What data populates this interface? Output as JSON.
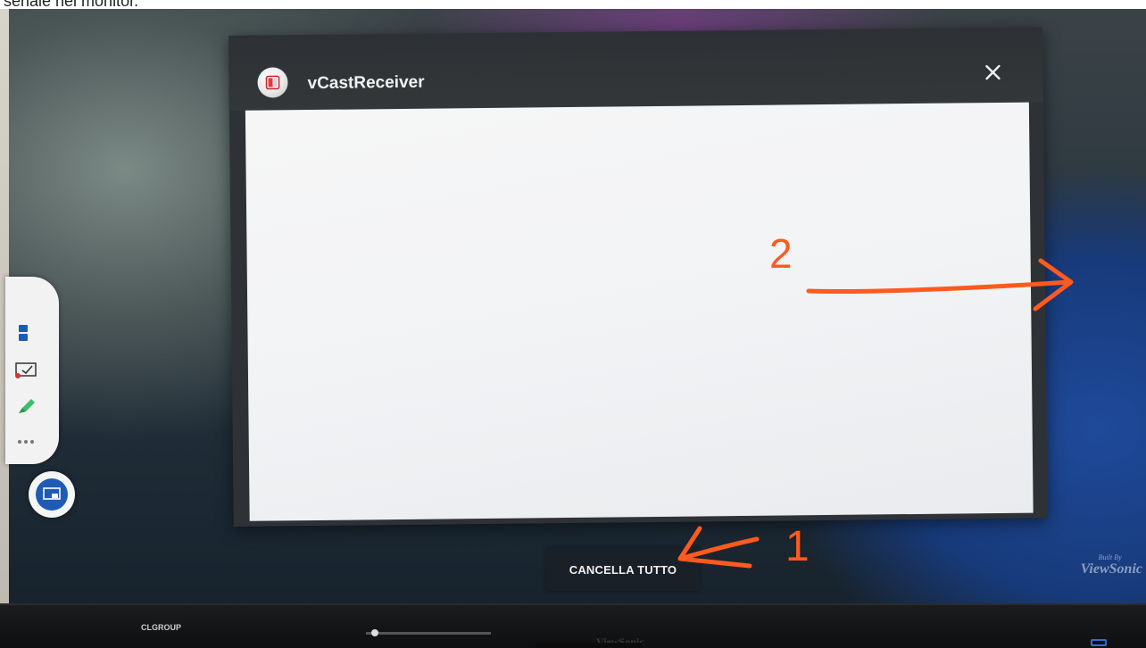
{
  "caption": {
    "text": "seriale nel monitor."
  },
  "dialog": {
    "title": "vCastReceiver",
    "close_glyph": "✕"
  },
  "bottom_button": {
    "label": "CANCELLA TUTTO"
  },
  "brand_watermark": {
    "small": "Built By",
    "big": "ViewSonic"
  },
  "bezel": {
    "left_logo": "CLGROUP",
    "center_brand": "ViewSonic"
  },
  "annotations": {
    "label_1": "1",
    "label_2": "2",
    "color": "#ff5a1f"
  },
  "colors": {
    "titlebar": "#2e3236",
    "content": "#f2f3f5",
    "button_bg": "#1a2027",
    "accent_blue": "#1e5bb5"
  },
  "icons": {
    "app": "vcast-app-icon",
    "close": "close-icon",
    "toolbar": [
      "shapes-icon",
      "check-icon",
      "marker-icon",
      "more-icon"
    ],
    "floating": "screen-share-icon"
  }
}
